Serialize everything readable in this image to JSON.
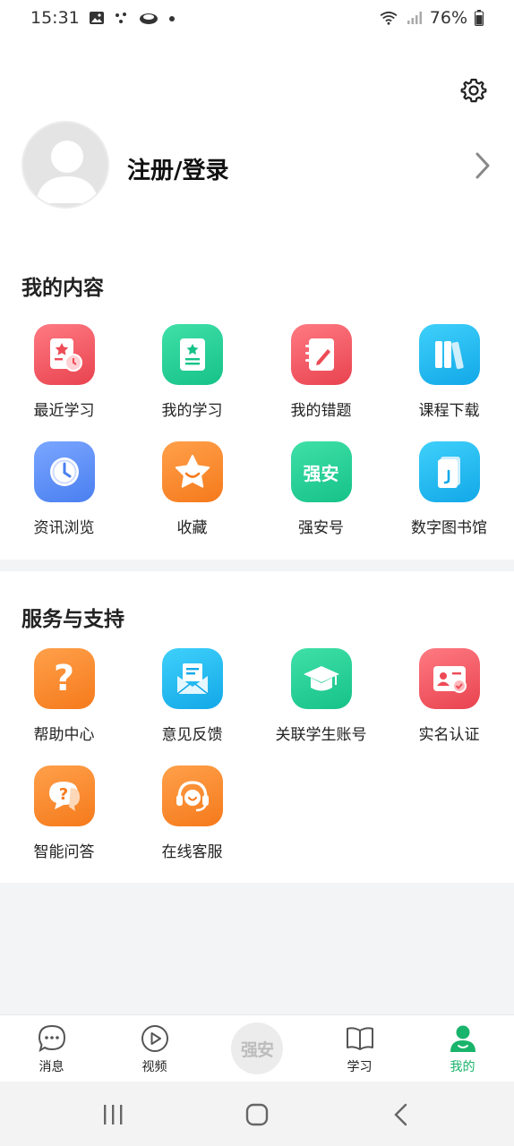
{
  "status": {
    "time": "15:31",
    "battery": "76%"
  },
  "profile": {
    "login_label": "注册/登录"
  },
  "content_section": {
    "title": "我的内容",
    "items": [
      {
        "label": "最近学习",
        "icon": "recent-study-icon",
        "color": "#f05a64"
      },
      {
        "label": "我的学习",
        "icon": "my-study-icon",
        "color": "#1fcf95"
      },
      {
        "label": "我的错题",
        "icon": "wrong-questions-icon",
        "color": "#f05a64"
      },
      {
        "label": "课程下载",
        "icon": "course-download-icon",
        "color": "#23b8f0"
      },
      {
        "label": "资讯浏览",
        "icon": "clock-icon",
        "color": "#5b8ff5"
      },
      {
        "label": "收藏",
        "icon": "star-icon",
        "color": "#fb8a2e"
      },
      {
        "label": "强安号",
        "icon": "qiangan-icon",
        "color": "#1fcf95",
        "badge": "强安"
      },
      {
        "label": "数字图书馆",
        "icon": "library-icon",
        "color": "#23b8f0"
      }
    ]
  },
  "services_section": {
    "title": "服务与支持",
    "items": [
      {
        "label": "帮助中心",
        "icon": "help-icon",
        "color": "#fb8a2e"
      },
      {
        "label": "意见反馈",
        "icon": "feedback-icon",
        "color": "#23b8f0"
      },
      {
        "label": "关联学生账号",
        "icon": "graduation-cap-icon",
        "color": "#1fcf95"
      },
      {
        "label": "实名认证",
        "icon": "id-card-icon",
        "color": "#f05a64"
      },
      {
        "label": "智能问答",
        "icon": "chat-question-icon",
        "color": "#fb8a2e"
      },
      {
        "label": "在线客服",
        "icon": "headset-icon",
        "color": "#fb8a2e"
      }
    ]
  },
  "tabbar": {
    "items": [
      {
        "label": "消息",
        "icon": "message-icon"
      },
      {
        "label": "视频",
        "icon": "video-icon"
      },
      {
        "label": "强安",
        "icon": "qiangan-logo"
      },
      {
        "label": "学习",
        "icon": "book-icon"
      },
      {
        "label": "我的",
        "icon": "person-icon",
        "active": true
      }
    ]
  },
  "colors": {
    "accent": "#19b46b"
  }
}
